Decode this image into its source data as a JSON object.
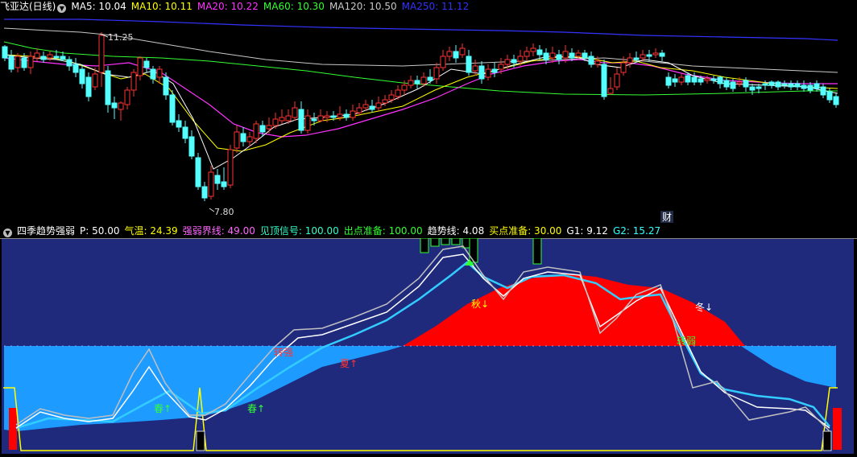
{
  "price_panel": {
    "stock_title": "飞亚达(日线)",
    "ma_legend": [
      {
        "label": "MA5: 10.04",
        "color": "#ffffff"
      },
      {
        "label": "MA10: 10.11",
        "color": "#ffff00"
      },
      {
        "label": "MA20: 10.22",
        "color": "#ff33ff"
      },
      {
        "label": "MA60: 10.30",
        "color": "#33ff33"
      },
      {
        "label": "MA120: 10.50",
        "color": "#c8c8c8"
      },
      {
        "label": "MA250: 11.12",
        "color": "#3333ff"
      }
    ],
    "high_label": "11.25",
    "low_label": "7.80",
    "event_marker": "财"
  },
  "indicator_panel": {
    "title": "四季趋势强弱",
    "legend": [
      {
        "label": "P: 50.00",
        "color": "#ffffff"
      },
      {
        "label": "气温: 24.39",
        "color": "#ffff00"
      },
      {
        "label": "强弱界线: 49.00",
        "color": "#ff66ff"
      },
      {
        "label": "见顶信号: 100.00",
        "color": "#33ffcc"
      },
      {
        "label": "出点准备: 100.00",
        "color": "#33ff33"
      },
      {
        "label": "趋势线: 4.08",
        "color": "#ffffff"
      },
      {
        "label": "买点准备: 30.00",
        "color": "#ffff00"
      },
      {
        "label": "G1: 9.12",
        "color": "#ffffff"
      },
      {
        "label": "G2: 15.27",
        "color": "#33ffff"
      }
    ],
    "annotations": {
      "spring1": "春↑",
      "spring2": "春↑",
      "strengthen": "转强",
      "summer": "夏↑",
      "autumn": "秋↓",
      "winter": "冬↓",
      "weaken": "转弱"
    }
  },
  "colors": {
    "up": "#ff3333",
    "down": "#54ffff",
    "panel_bg": "#1f2a7d",
    "zone_light": "#1e9bff",
    "summer_red": "#ff0000"
  }
}
